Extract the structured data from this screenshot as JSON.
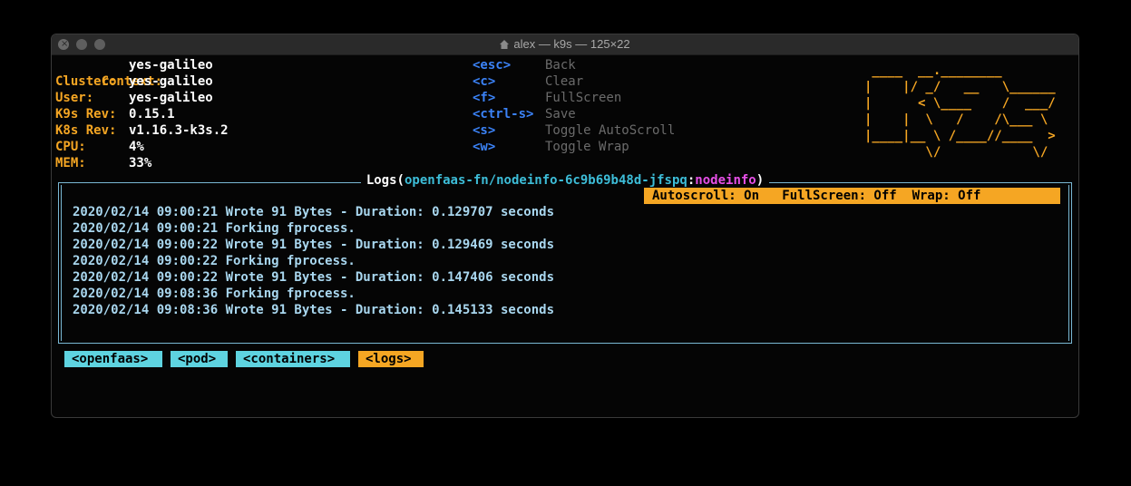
{
  "window": {
    "title": "alex — k9s — 125×22"
  },
  "info": [
    {
      "label": "Context:",
      "value": "yes-galileo"
    },
    {
      "label": "Cluster:",
      "value": "yes-galileo"
    },
    {
      "label": "User:",
      "value": "yes-galileo"
    },
    {
      "label": "K9s Rev:",
      "value": "0.15.1"
    },
    {
      "label": "K8s Rev:",
      "value": "v1.16.3-k3s.2"
    },
    {
      "label": "CPU:",
      "value": "4%"
    },
    {
      "label": "MEM:",
      "value": "33%"
    }
  ],
  "shortcuts": [
    {
      "key": "<esc>",
      "action": "Back"
    },
    {
      "key": "<c>",
      "action": "Clear"
    },
    {
      "key": "<f>",
      "action": "FullScreen"
    },
    {
      "key": "<ctrl-s>",
      "action": "Save"
    },
    {
      "key": "<s>",
      "action": "Toggle AutoScroll"
    },
    {
      "key": "<w>",
      "action": "Toggle Wrap"
    }
  ],
  "logo": " ____  __.________\n|    |/ _/   __   \\______\n|      < \\____    /  ___/\n|    |  \\   /    /\\___ \\\n|____|__ \\ /____//____  >\n        \\/            \\/",
  "panel": {
    "title_prefix": "Logs(",
    "namespace_pod": "openfaas-fn/nodeinfo-6c9b69b48d-jfspq",
    "separator": ":",
    "container": "nodeinfo",
    "title_suffix": ")",
    "status": "Autoscroll: On   FullScreen: Off  Wrap: Off"
  },
  "logs": [
    "2020/02/14 09:00:21 Wrote 91 Bytes - Duration: 0.129707 seconds",
    "2020/02/14 09:00:21 Forking fprocess.",
    "2020/02/14 09:00:22 Wrote 91 Bytes - Duration: 0.129469 seconds",
    "2020/02/14 09:00:22 Forking fprocess.",
    "2020/02/14 09:00:22 Wrote 91 Bytes - Duration: 0.147406 seconds",
    "2020/02/14 09:08:36 Forking fprocess.",
    "2020/02/14 09:08:36 Wrote 91 Bytes - Duration: 0.145133 seconds"
  ],
  "breadcrumbs": [
    "<openfaas>",
    "<pod>",
    "<containers>",
    "<logs>"
  ],
  "colors": {
    "accent": "#f5a623",
    "key": "#3b82f6",
    "log_text": "#a9d7ef",
    "border": "#7ab8d4",
    "crumb": "#5ed3e0",
    "container": "#e64fe6"
  }
}
